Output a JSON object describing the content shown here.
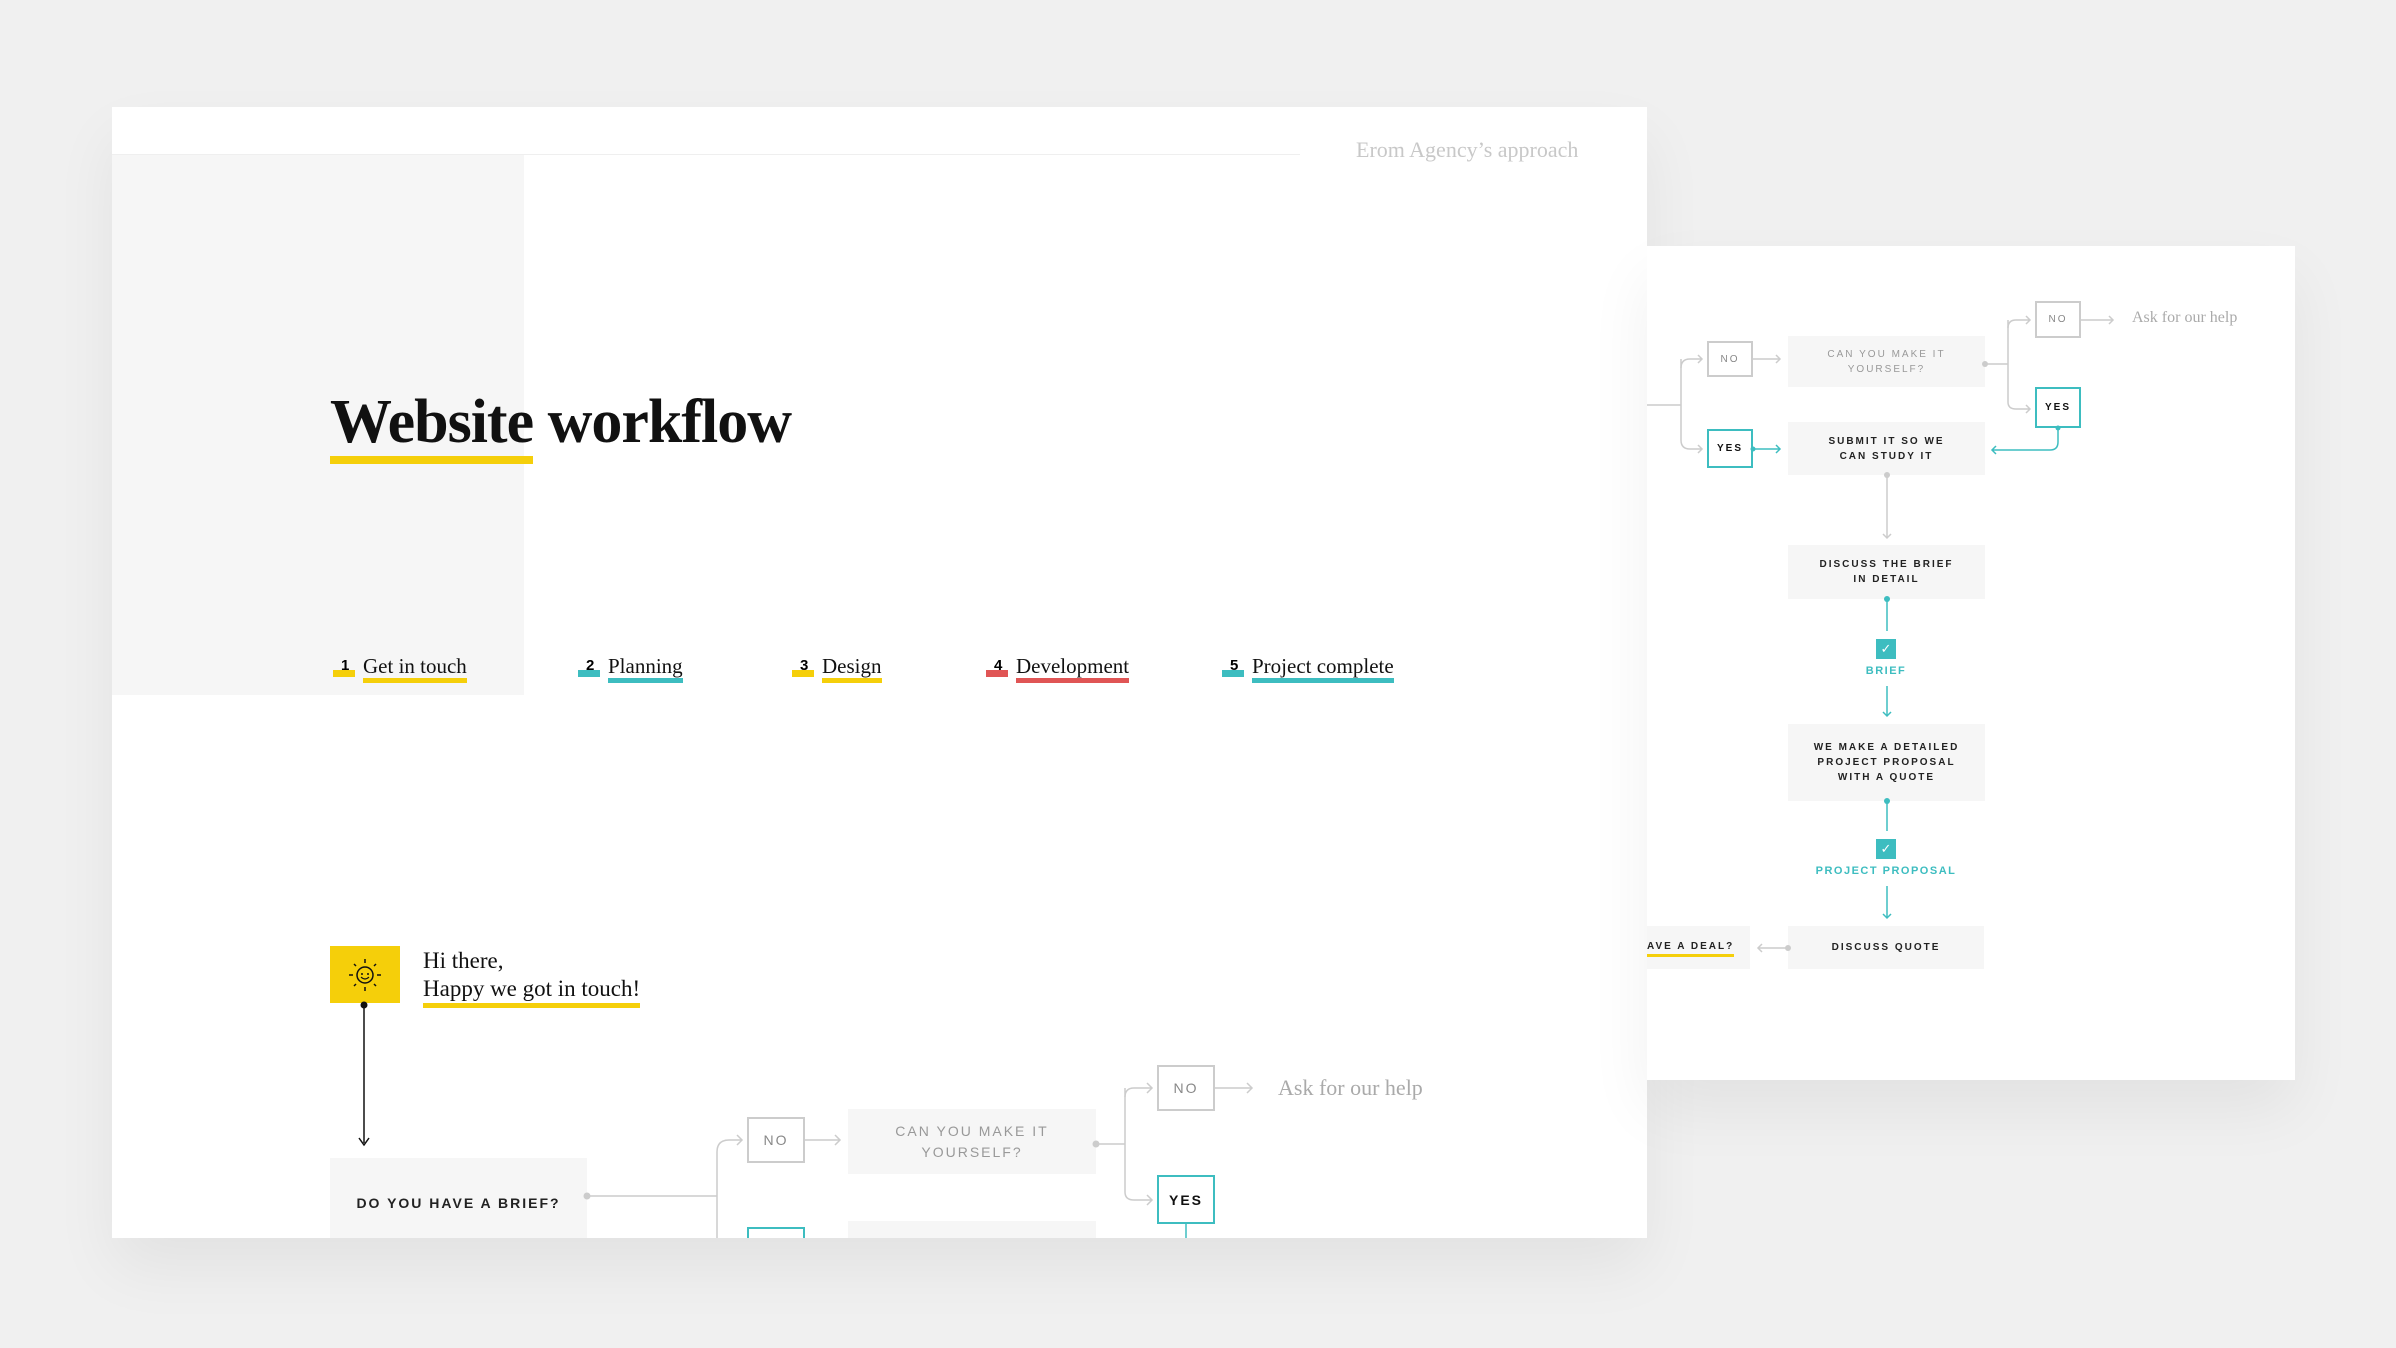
{
  "header": {
    "subtitle": "Erom Agency’s approach"
  },
  "title": {
    "text": "Website workflow",
    "underlined_word": "Website",
    "rest": " workflow"
  },
  "steps": [
    {
      "num": "1",
      "label": "Get in touch",
      "color": "#f5cf0a"
    },
    {
      "num": "2",
      "label": "Planning",
      "color": "#3dbdc0"
    },
    {
      "num": "3",
      "label": "Design",
      "color": "#f5cf0a"
    },
    {
      "num": "4",
      "label": "Development",
      "color": "#e05555"
    },
    {
      "num": "5",
      "label": "Project complete",
      "color": "#3dbdc0"
    }
  ],
  "intro": {
    "icon": "sun-icon",
    "line1": "Hi there,",
    "line2": "Happy we got in touch!"
  },
  "main_flow": {
    "q1": "Do you have a brief?",
    "no": "NO",
    "yes": "YES",
    "q2": "Can you make it yourself?",
    "help": "Ask for our help"
  },
  "back_flow": {
    "no": "NO",
    "yes": "YES",
    "q2": "Can you make it yourself?",
    "help": "Ask for our help",
    "submit": "Submit it so we can study it",
    "discuss_brief": "Discuss the brief in detail",
    "brief_label": "BRIEF",
    "proposal": "We make a detailed project proposal with a quote",
    "proposal_label": "PROJECT PROPOSAL",
    "discuss_quote": "Discuss quote",
    "deal": "AVE A DEAL?"
  },
  "colors": {
    "yellow": "#f5cf0a",
    "teal": "#3dbdc0",
    "red": "#e05555",
    "box": "#f6f6f6"
  }
}
